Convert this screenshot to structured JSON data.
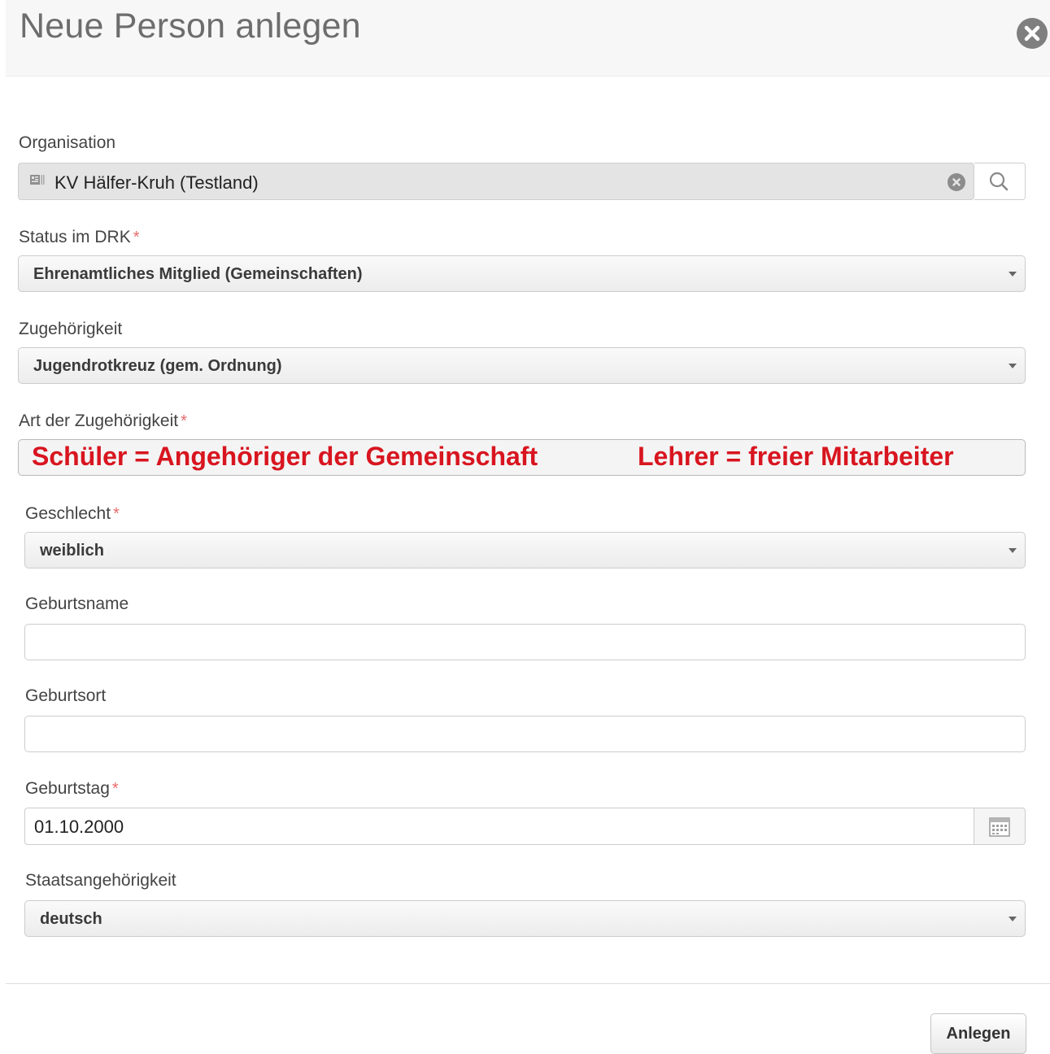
{
  "dialog": {
    "title": "Neue Person anlegen",
    "close_icon": "close-circle-icon"
  },
  "organisation": {
    "label": "Organisation",
    "value": "KV Hälfer-Kruh (Testland)",
    "value_icon": "id-card-icon",
    "clear_icon": "clear-circle-icon",
    "search_icon": "search-icon"
  },
  "status": {
    "label": "Status im DRK",
    "required_mark": "*",
    "value": "Ehrenamtliches Mitglied (Gemeinschaften)"
  },
  "zugehoerigkeit": {
    "label": "Zugehörigkeit",
    "value": "Jugendrotkreuz (gem. Ordnung)"
  },
  "art_zugehoerigkeit": {
    "label": "Art der Zugehörigkeit",
    "required_mark": "*",
    "annotation_left": "Schüler = Angehöriger der Gemeinschaft",
    "annotation_right": "Lehrer = freier Mitarbeiter",
    "annotation_color": "#d8151f"
  },
  "geschlecht": {
    "label": "Geschlecht",
    "required_mark": "*",
    "value": "weiblich"
  },
  "geburtsname": {
    "label": "Geburtsname",
    "value": ""
  },
  "geburtsort": {
    "label": "Geburtsort",
    "value": ""
  },
  "geburtstag": {
    "label": "Geburtstag",
    "required_mark": "*",
    "value": "01.10.2000",
    "calendar_icon": "calendar-icon"
  },
  "staatsangehoerigkeit": {
    "label": "Staatsangehörigkeit",
    "value": "deutsch"
  },
  "footer": {
    "submit_label": "Anlegen"
  },
  "colors": {
    "required": "#e86a6a",
    "header_bg": "#f7f7f7"
  }
}
